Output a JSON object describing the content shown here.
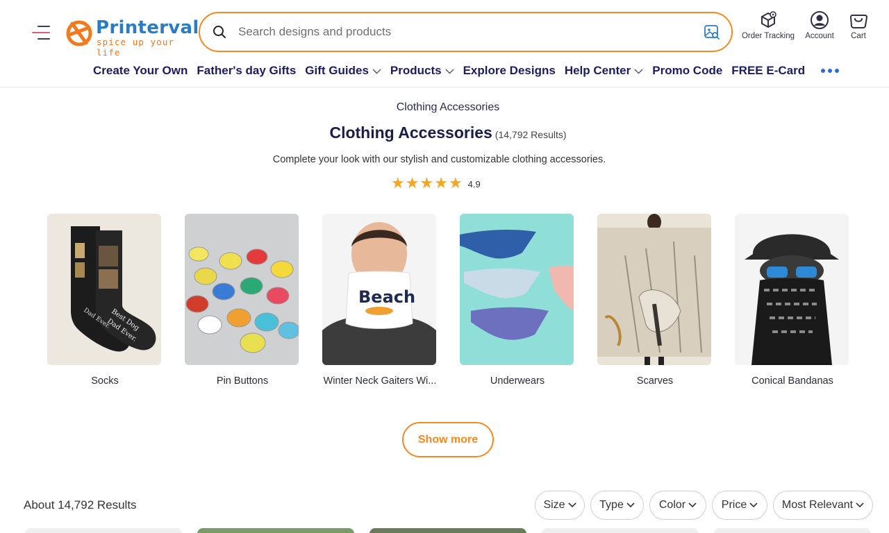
{
  "header": {
    "brand_name": "Printerval",
    "tagline": "spice up your life",
    "search": {
      "placeholder": "Search designs and products"
    },
    "actions": [
      {
        "label": "Order Tracking",
        "icon": "package-icon"
      },
      {
        "label": "Account",
        "icon": "user-icon"
      },
      {
        "label": "Cart",
        "icon": "cart-icon"
      }
    ],
    "colors": {
      "brand_blue": "#2b7dc3",
      "accent_orange": "#f08a24",
      "nav_text": "#1c1c5e"
    }
  },
  "nav": {
    "items": [
      {
        "label": "Create Your Own",
        "dropdown": false
      },
      {
        "label": "Father's day Gifts",
        "dropdown": false
      },
      {
        "label": "Gift Guides",
        "dropdown": true
      },
      {
        "label": "Products",
        "dropdown": true
      },
      {
        "label": "Explore Designs",
        "dropdown": false
      },
      {
        "label": "Help Center",
        "dropdown": true
      },
      {
        "label": "Promo Code",
        "dropdown": false
      },
      {
        "label": "FREE E-Card",
        "dropdown": false
      }
    ]
  },
  "category": {
    "breadcrumb": "Clothing Accessories",
    "title": "Clothing Accessories",
    "count": "(14,792 Results)",
    "description": "Complete your look with our stylish and customizable clothing accessories.",
    "rating": "4.9",
    "rating_stars": 5,
    "items": [
      {
        "label": "Socks",
        "icon": "socks-image"
      },
      {
        "label": "Pin Buttons",
        "icon": "pin-buttons-image"
      },
      {
        "label": "Winter Neck Gaiters Wi...",
        "icon": "neck-gaiter-image"
      },
      {
        "label": "Underwears",
        "icon": "underwear-image"
      },
      {
        "label": "Scarves",
        "icon": "scarf-image"
      },
      {
        "label": "Conical Bandanas",
        "icon": "bandana-image"
      }
    ],
    "show_more": "Show more"
  },
  "listing": {
    "results_label": "About 14,792 Results",
    "filters": [
      {
        "label": "Size"
      },
      {
        "label": "Type"
      },
      {
        "label": "Color"
      },
      {
        "label": "Price"
      }
    ],
    "sort": {
      "label": "Most Relevant"
    }
  }
}
